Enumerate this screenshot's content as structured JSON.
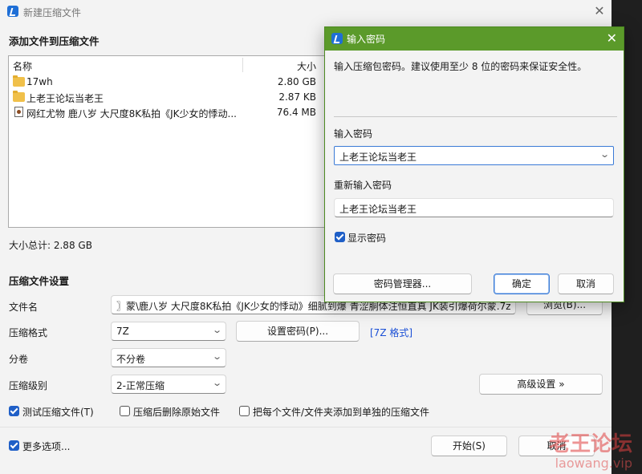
{
  "window": {
    "title": "新建压缩文件",
    "close_glyph": "✕"
  },
  "files_section": {
    "heading": "添加文件到压缩文件",
    "columns": {
      "name": "名称",
      "size": "大小"
    },
    "rows": [
      {
        "icon": "folder-icon",
        "name": "17wh",
        "size": "2.80 GB"
      },
      {
        "icon": "folder-icon",
        "name": "上老王论坛当老王",
        "size": "2.87 KB"
      },
      {
        "icon": "file-icon",
        "name": "网红尤物 鹿八岁 大尺度8K私拍《JK少女的悸动...",
        "size": "76.4 MB"
      }
    ],
    "total": "大小总计: 2.88 GB"
  },
  "settings": {
    "heading": "压缩文件设置",
    "filename_label": "文件名",
    "filename_value": "〗蒙\\鹿八岁 大尺度8K私拍《JK少女的悸动》细腻到爆 青涩胴体注恒直真 JK装引爆荷尔蒙.7z",
    "browse_label": "浏览(B)...",
    "format_label": "压缩格式",
    "format_value": "7Z",
    "set_password_label": "设置密码(P)...",
    "format_link": "[7Z 格式]",
    "split_label": "分卷",
    "split_value": "不分卷",
    "level_label": "压缩级别",
    "level_value": "2-正常压缩",
    "advanced_label": "高级设置 »",
    "test_label": "测试压缩文件(T)",
    "test_checked": true,
    "delete_label": "压缩后删除原始文件",
    "delete_checked": false,
    "separate_label": "把每个文件/文件夹添加到单独的压缩文件",
    "separate_checked": false,
    "more_label": "更多选项...",
    "more_checked": true,
    "start_label": "开始(S)",
    "cancel_label": "取消"
  },
  "password_dialog": {
    "title": "输入密码",
    "close_glyph": "✕",
    "hint": "输入压缩包密码。建议使用至少 8 位的密码来保证安全性。",
    "password_label": "输入密码",
    "password_value": "上老王论坛当老王",
    "confirm_label": "重新输入密码",
    "confirm_value": "上老王论坛当老王",
    "show_label": "显示密码",
    "show_checked": true,
    "manager_label": "密码管理器...",
    "ok_label": "确定",
    "cancel_label": "取消"
  },
  "watermark": {
    "line1": "老王论坛",
    "line2": "laowang.vip"
  },
  "colors": {
    "accent": "#1f5fc7",
    "dialog_title": "#5b9a2a",
    "link": "#1a4fd6"
  }
}
